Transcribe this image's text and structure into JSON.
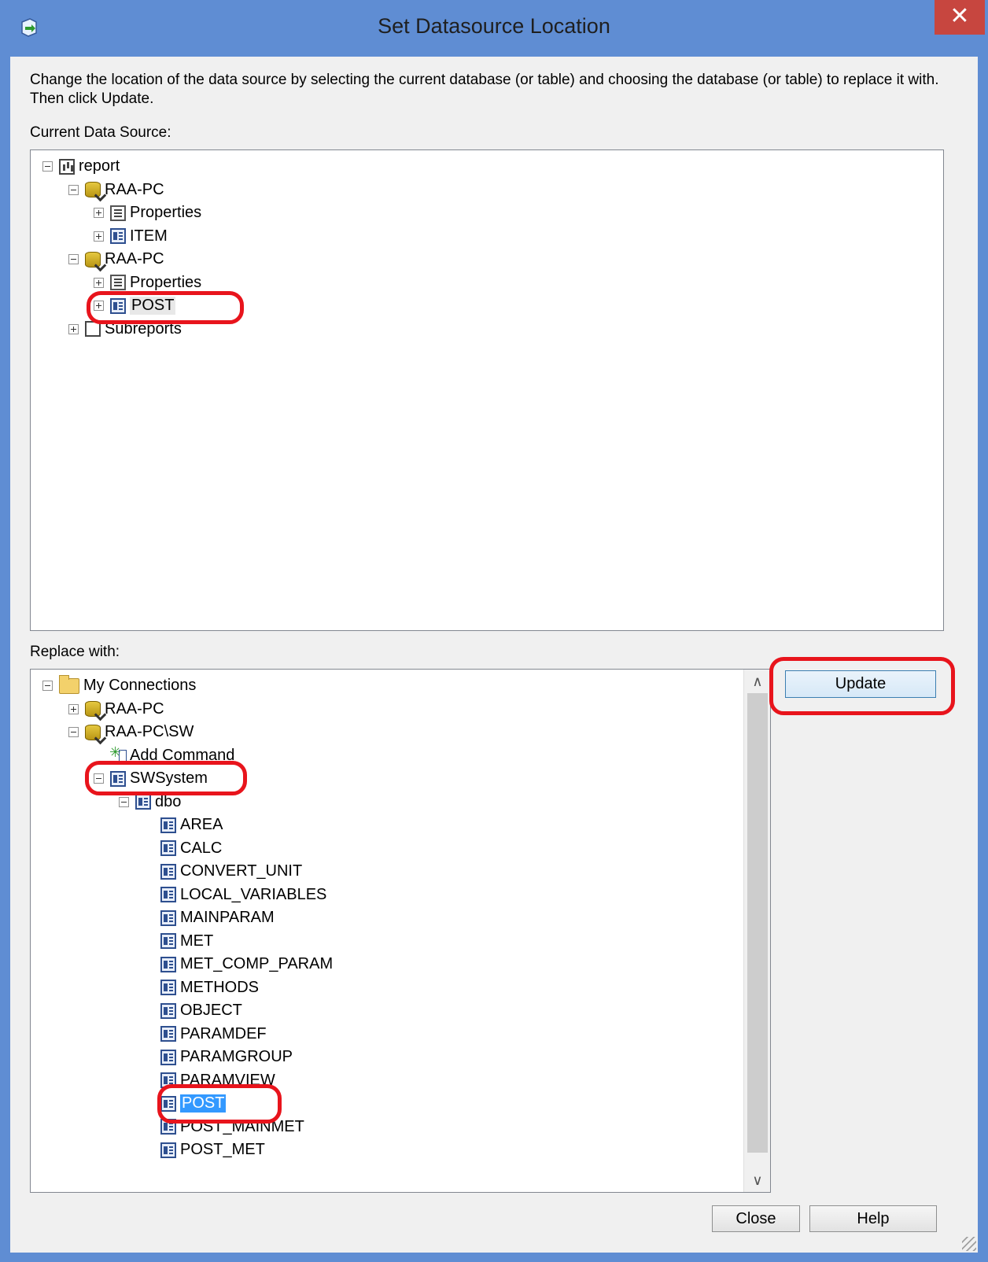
{
  "window": {
    "title": "Set Datasource Location",
    "close_glyph": "✕"
  },
  "instructions": "Change the location of the data source by selecting the current database (or table) and choosing the database (or table) to replace it with.  Then click Update.",
  "current": {
    "label": "Current Data Source:",
    "items": [
      {
        "label": "report",
        "icon": "report-icon",
        "expander": "minus"
      },
      {
        "label": "RAA-PC",
        "icon": "database-icon",
        "expander": "minus"
      },
      {
        "label": "Properties",
        "icon": "properties-icon",
        "expander": "plus"
      },
      {
        "label": "ITEM",
        "icon": "table-icon",
        "expander": "plus"
      },
      {
        "label": "RAA-PC",
        "icon": "database-icon",
        "expander": "minus"
      },
      {
        "label": "Properties",
        "icon": "properties-icon",
        "expander": "plus"
      },
      {
        "label": "POST",
        "icon": "table-icon",
        "expander": "plus"
      },
      {
        "label": "Subreports",
        "icon": "subreports-icon",
        "expander": "plus"
      }
    ]
  },
  "replace": {
    "label": "Replace with:",
    "items": [
      {
        "label": "My Connections",
        "icon": "folder-icon",
        "expander": "minus"
      },
      {
        "label": "RAA-PC",
        "icon": "database-icon",
        "expander": "plus"
      },
      {
        "label": "RAA-PC\\SW",
        "icon": "database-icon",
        "expander": "minus"
      },
      {
        "label": "Add Command",
        "icon": "add-command-icon",
        "expander": "none"
      },
      {
        "label": "SWSystem",
        "icon": "table-icon",
        "expander": "minus"
      },
      {
        "label": "dbo",
        "icon": "table-icon",
        "expander": "minus"
      },
      {
        "label": "AREA",
        "icon": "table-icon",
        "expander": "none"
      },
      {
        "label": "CALC",
        "icon": "table-icon",
        "expander": "none"
      },
      {
        "label": "CONVERT_UNIT",
        "icon": "table-icon",
        "expander": "none"
      },
      {
        "label": "LOCAL_VARIABLES",
        "icon": "table-icon",
        "expander": "none"
      },
      {
        "label": "MAINPARAM",
        "icon": "table-icon",
        "expander": "none"
      },
      {
        "label": "MET",
        "icon": "table-icon",
        "expander": "none"
      },
      {
        "label": "MET_COMP_PARAM",
        "icon": "table-icon",
        "expander": "none"
      },
      {
        "label": "METHODS",
        "icon": "table-icon",
        "expander": "none"
      },
      {
        "label": "OBJECT",
        "icon": "table-icon",
        "expander": "none"
      },
      {
        "label": "PARAMDEF",
        "icon": "table-icon",
        "expander": "none"
      },
      {
        "label": "PARAMGROUP",
        "icon": "table-icon",
        "expander": "none"
      },
      {
        "label": "PARAMVIEW",
        "icon": "table-icon",
        "expander": "none"
      },
      {
        "label": "POST",
        "icon": "table-icon",
        "expander": "none"
      },
      {
        "label": "POST_MAINMET",
        "icon": "table-icon",
        "expander": "none"
      },
      {
        "label": "POST_MET",
        "icon": "table-icon",
        "expander": "none"
      }
    ],
    "selected": "POST"
  },
  "buttons": {
    "update": "Update",
    "close": "Close",
    "help": "Help"
  },
  "colors": {
    "titlebar": "#5f8dd3",
    "close": "#c7463f",
    "selection": "#3399ff",
    "annotation": "#e8141c"
  }
}
